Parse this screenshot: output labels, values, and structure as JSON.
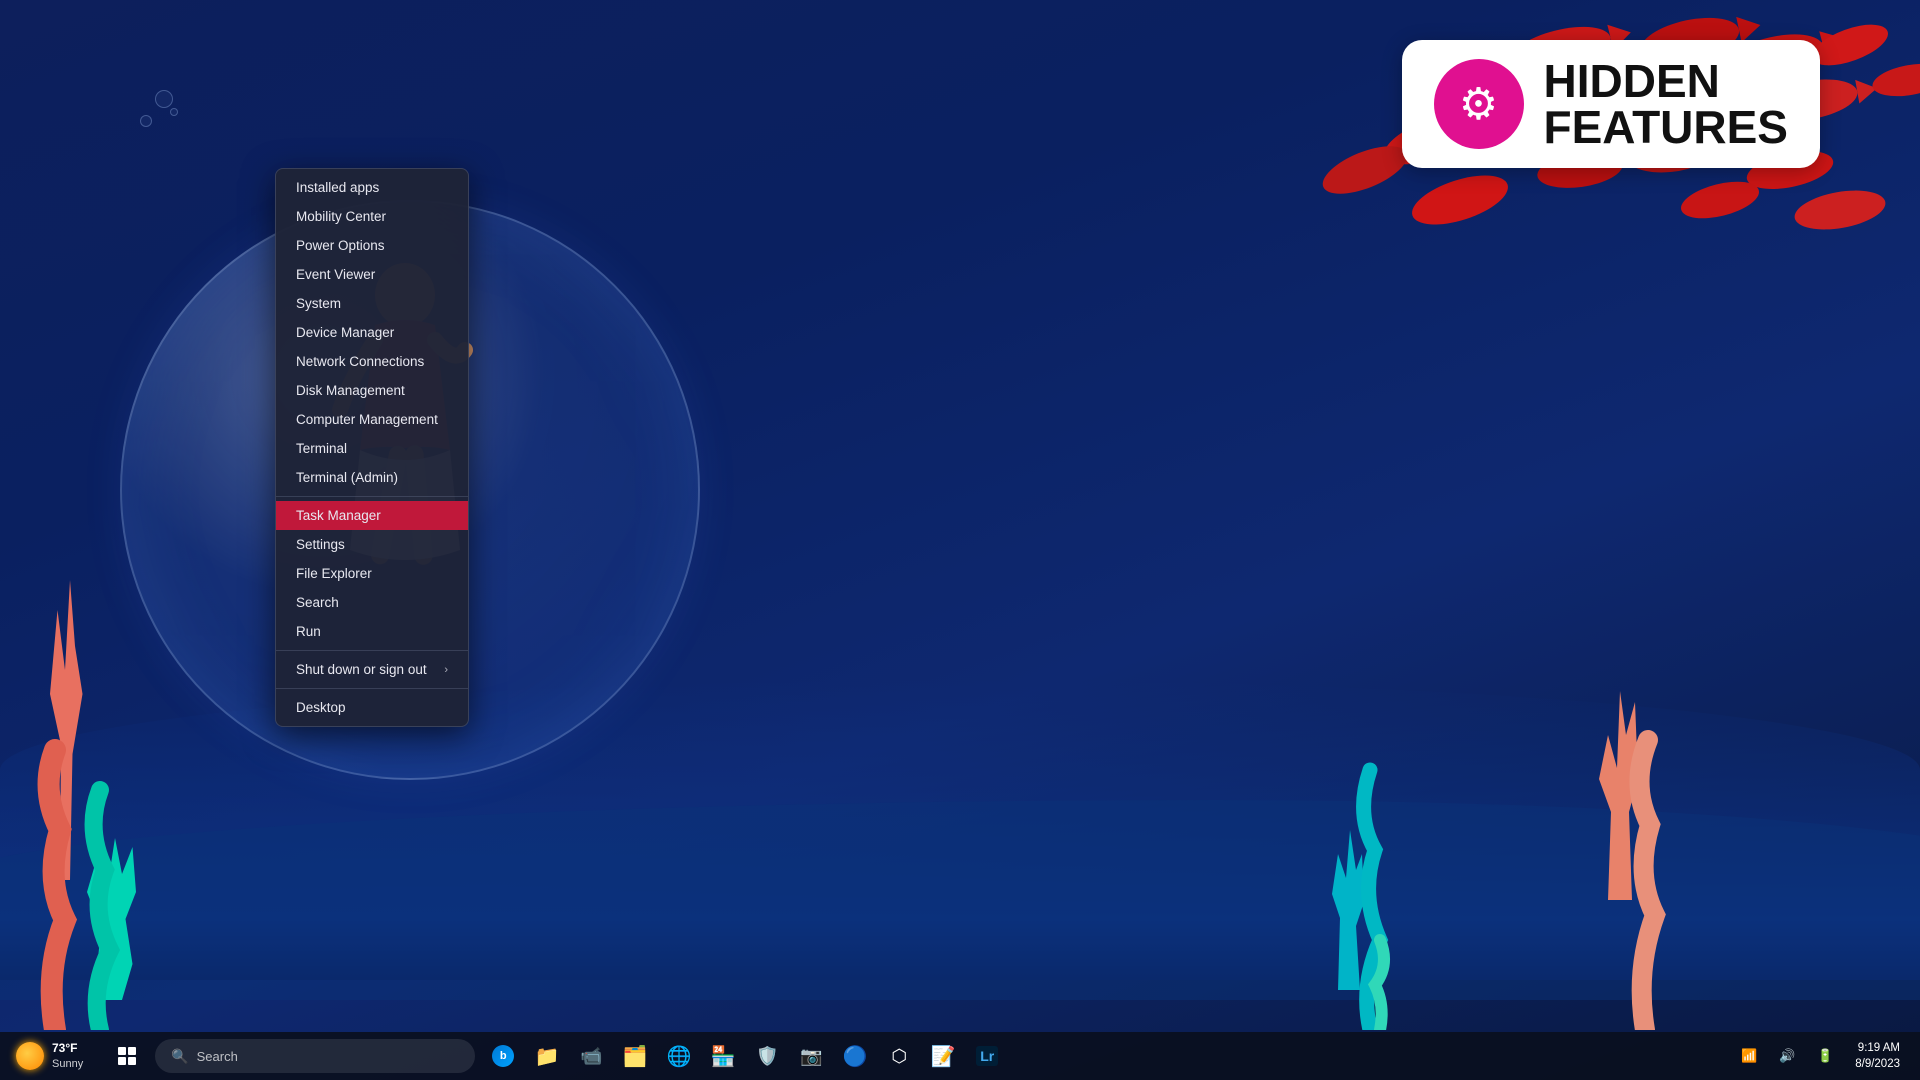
{
  "desktop": {
    "background": "underwater"
  },
  "badge": {
    "title_line1": "HIDDEN",
    "title_line2": "FEATURES",
    "gear_icon": "⚙"
  },
  "context_menu": {
    "items": [
      {
        "id": "installed-apps",
        "label": "Installed apps",
        "highlighted": false,
        "has_arrow": false
      },
      {
        "id": "mobility-center",
        "label": "Mobility Center",
        "highlighted": false,
        "has_arrow": false
      },
      {
        "id": "power-options",
        "label": "Power Options",
        "highlighted": false,
        "has_arrow": false
      },
      {
        "id": "event-viewer",
        "label": "Event Viewer",
        "highlighted": false,
        "has_arrow": false
      },
      {
        "id": "system",
        "label": "System",
        "highlighted": false,
        "has_arrow": false
      },
      {
        "id": "device-manager",
        "label": "Device Manager",
        "highlighted": false,
        "has_arrow": false
      },
      {
        "id": "network-connections",
        "label": "Network Connections",
        "highlighted": false,
        "has_arrow": false
      },
      {
        "id": "disk-management",
        "label": "Disk Management",
        "highlighted": false,
        "has_arrow": false
      },
      {
        "id": "computer-management",
        "label": "Computer Management",
        "highlighted": false,
        "has_arrow": false
      },
      {
        "id": "terminal",
        "label": "Terminal",
        "highlighted": false,
        "has_arrow": false
      },
      {
        "id": "terminal-admin",
        "label": "Terminal (Admin)",
        "highlighted": false,
        "has_arrow": false
      },
      {
        "id": "task-manager",
        "label": "Task Manager",
        "highlighted": true,
        "has_arrow": false
      },
      {
        "id": "settings",
        "label": "Settings",
        "highlighted": false,
        "has_arrow": false
      },
      {
        "id": "file-explorer",
        "label": "File Explorer",
        "highlighted": false,
        "has_arrow": false
      },
      {
        "id": "search",
        "label": "Search",
        "highlighted": false,
        "has_arrow": false
      },
      {
        "id": "run",
        "label": "Run",
        "highlighted": false,
        "has_arrow": false
      },
      {
        "id": "shut-down",
        "label": "Shut down or sign out",
        "highlighted": false,
        "has_arrow": true
      },
      {
        "id": "desktop",
        "label": "Desktop",
        "highlighted": false,
        "has_arrow": false
      }
    ]
  },
  "taskbar": {
    "weather": {
      "temperature": "73°F",
      "condition": "Sunny"
    },
    "search_placeholder": "Search",
    "clock": {
      "time": "9:19 AM",
      "date": "8/9/2023"
    }
  }
}
